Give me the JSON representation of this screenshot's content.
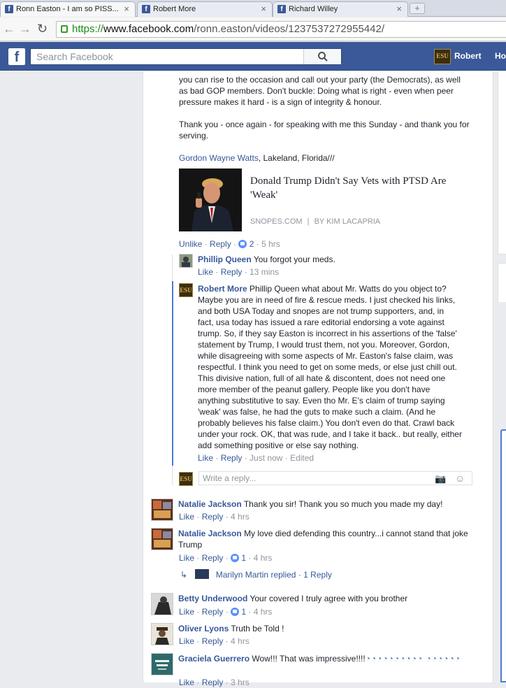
{
  "browser": {
    "tabs": [
      {
        "title": "Ronn Easton - I am so PISS...",
        "favicon": "f"
      },
      {
        "title": "Robert More",
        "favicon": "f"
      },
      {
        "title": "Richard Willey",
        "favicon": "f"
      }
    ],
    "url": {
      "scheme": "https://",
      "host": "www.facebook.com",
      "path": "/ronn.easton/videos/1237537272955442/"
    }
  },
  "fb": {
    "logo": "f",
    "search_placeholder": "Search Facebook",
    "user_name": "Robert",
    "home_label": "Ho",
    "avatar_text": "ESU"
  },
  "post": {
    "lines": [
      "you can rise to the occasion and call out your party (the Democrats), as well",
      "as bad GOP members. Don't buckle: Doing what is right - even when peer",
      "pressure makes it hard - is a sign of integrity & honour."
    ],
    "thanks_lines": [
      "Thank you - once again - for speaking with me this Sunday - and thank you for",
      "serving."
    ],
    "signature_name": "Gordon Wayne Watts",
    "signature_rest": ", Lakeland, Florida///",
    "link_card": {
      "title_line1": "Donald Trump Didn't Say Vets with PTSD Are",
      "title_line2": "'Weak'",
      "source": "SNOPES.COM",
      "sep": "|",
      "author": "BY KIM LACAPRIA"
    },
    "actions": {
      "unlike": "Unlike",
      "reply": "Reply",
      "likes": "2",
      "time": "5 hrs"
    }
  },
  "replies": [
    {
      "name": "Phillip Queen",
      "text": "You forgot your meds.",
      "like": "Like",
      "reply": "Reply",
      "time": "13 mins"
    },
    {
      "name": "Robert More",
      "lines": [
        "Phillip Queen what about Mr. Watts do you object to?",
        "Maybe you are in need of fire & rescue meds. I just checked his links,",
        "and both USA Today and snopes are not trump supporters, and, in",
        "fact, usa today has issued a rare editorial endorsing a vote against",
        "trump. So, if they say Easton is incorrect in his assertions of the 'false'",
        "statement by Trump, I would trust them, not you. Moreover, Gordon,",
        "while disagreeing with some aspects of Mr. Easton's false claim, was",
        "respectful. I think you need to get on some meds, or else just chill out.",
        "This divisive nation, full of all hate & discontent, does not need one",
        "more member of the peanut gallery. People like you don't have",
        "anything substitutive to say. Even tho Mr. E's claim of trump saying",
        "'weak' was false, he had the guts to make such a claim. (And he",
        "probably believes his false claim.) You don't even do that. Crawl back",
        "under your rock. OK, that was rude, and I take it back.. but really, either",
        "add something positive or else say nothing."
      ],
      "like": "Like",
      "reply": "Reply",
      "time": "Just now",
      "edited": "Edited"
    }
  ],
  "write_reply_placeholder": "Write a reply...",
  "comments": [
    {
      "name": "Natalie Jackson",
      "text": "Thank you sir! Thank you so much you made my day!",
      "like": "Like",
      "reply": "Reply",
      "time": "4 hrs"
    },
    {
      "name": "Natalie Jackson",
      "text1": "My love died defending this country...i cannot stand that joke",
      "text2": "Trump",
      "like": "Like",
      "reply": "Reply",
      "likes": "1",
      "time": "4 hrs",
      "replied": {
        "name": "Marilyn Martin",
        "verb": "replied",
        "sep": "·",
        "count": "1 Reply"
      }
    },
    {
      "name": "Betty Underwood",
      "text": "Your covered I truly agree with you brother",
      "like": "Like",
      "reply": "Reply",
      "likes": "1",
      "time": "4 hrs"
    },
    {
      "name": "Oliver Lyons",
      "text": "Truth be Told !",
      "like": "Like",
      "reply": "Reply",
      "time": "4 hrs"
    },
    {
      "name": "Graciela Guerrero",
      "text": "Wow!!! That was impressive!!!!",
      "emoji": "(hand-clap emoji ×16)",
      "like": "Like",
      "reply": "Reply",
      "time": "3 hrs"
    }
  ],
  "colors": {
    "fb_blue": "#3b5998",
    "link": "#365899",
    "meta": "#90949c",
    "like_blue": "#5890ff"
  }
}
